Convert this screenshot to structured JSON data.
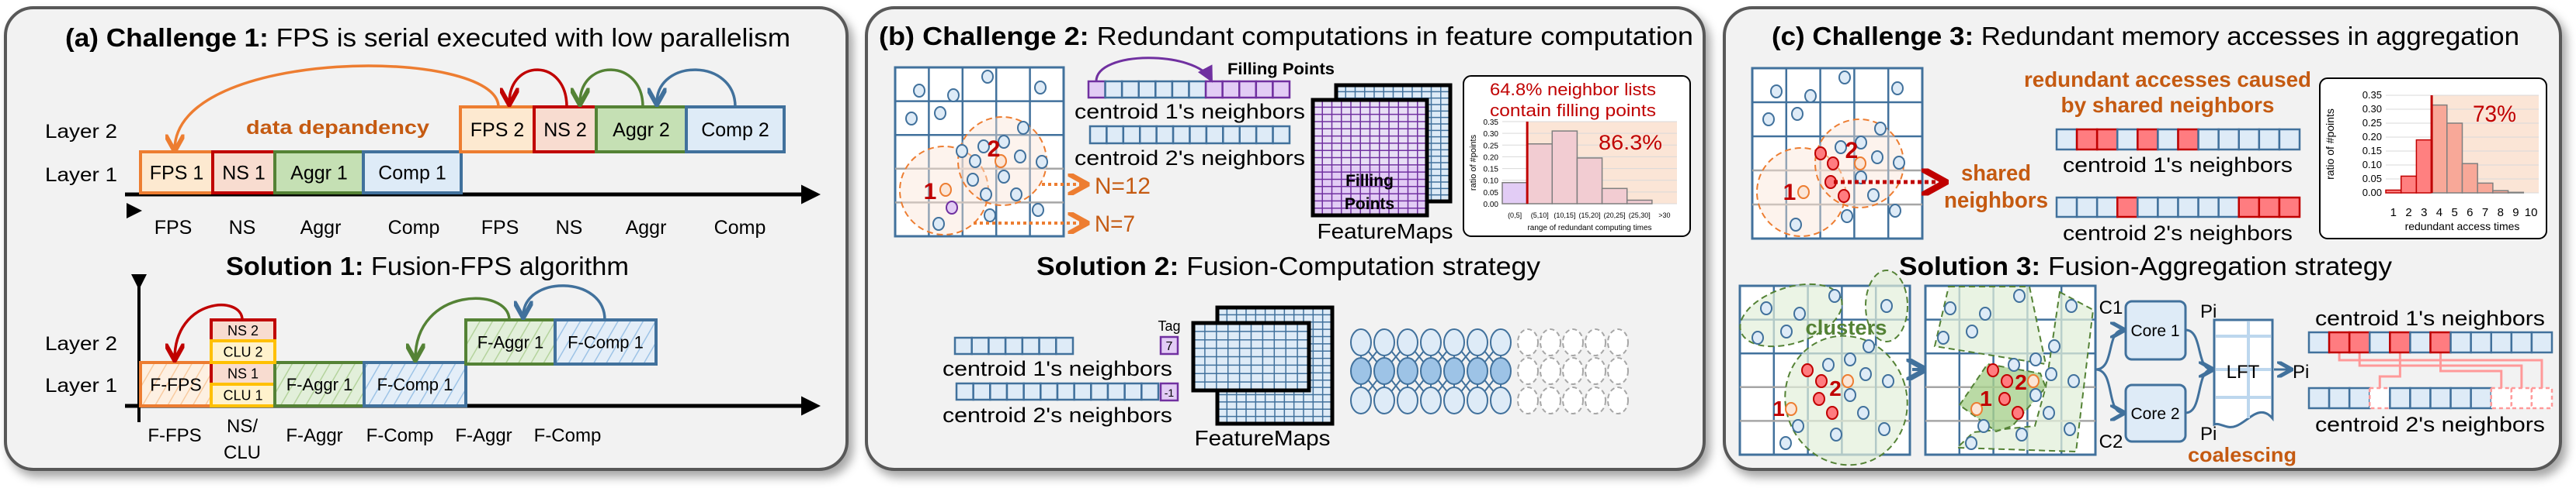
{
  "colors": {
    "fps": "#ed7d31",
    "ns": "#c00000",
    "aggr": "#548235",
    "comp": "#41719c",
    "clu": "#ffc000",
    "filling": "#7030a0",
    "annotation": "#c55a11",
    "highlight": "#c00000",
    "panel_bg": "#f2f2f2",
    "panel_border": "#595959"
  },
  "panel_a": {
    "title_prefix": "(a) Challenge 1:",
    "title_rest": " FPS is serial executed with low parallelism",
    "layer_labels": [
      "Layer 2",
      "Layer 1"
    ],
    "challenge": {
      "layer1_boxes": [
        "FPS 1",
        "NS 1",
        "Aggr 1",
        "Comp 1"
      ],
      "layer2_boxes": [
        "FPS 2",
        "NS 2",
        "Aggr 2",
        "Comp 2"
      ],
      "x_labels": [
        "FPS",
        "NS",
        "Aggr",
        "Comp",
        "FPS",
        "NS",
        "Aggr",
        "Comp"
      ],
      "annotation": "data depandency"
    },
    "solution_prefix": "Solution 1:",
    "solution_rest": " Fusion-FPS algorithm",
    "solution": {
      "layer1_boxes": [
        "F-FPS",
        "NS 1",
        "CLU 1",
        "F-Aggr 1",
        "F-Comp 1"
      ],
      "layer2_boxes": [
        "NS 2",
        "CLU 2",
        "F-Aggr 1",
        "F-Comp 1"
      ],
      "x_labels": [
        "F-FPS",
        "NS/",
        "CLU",
        "F-Aggr",
        "F-Comp",
        "F-Aggr",
        "F-Comp"
      ]
    }
  },
  "panel_b": {
    "title_prefix": "(b) Challenge 2:",
    "title_rest": " Redundant computations in feature computation",
    "centroid_labels": [
      "1",
      "2"
    ],
    "filling_points_label": "Filling Points",
    "neighbor_labels": [
      "centroid 1's neighbors",
      "centroid 2's neighbors"
    ],
    "n_labels": [
      "N=12",
      "N=7"
    ],
    "featuremaps_label": "FeatureMaps",
    "featuremap_filling": [
      "Filling",
      "Points"
    ],
    "histogram": {
      "type": "bar",
      "annotation": [
        "64.8% neighbor lists",
        "contain filling points"
      ],
      "highlight": "86.3%",
      "ylabel": "ratio of #points",
      "xlabel": "range of redundant computing times",
      "categories": [
        "(0,5]",
        "(5,10]",
        "(10,15]",
        "(15,20]",
        "(20,25]",
        "(25,30]",
        ">30"
      ],
      "values": [
        0.09,
        0.255,
        0.31,
        0.195,
        0.065,
        0.015,
        0.0
      ],
      "yticks": [
        "0.00",
        "0.05",
        "0.10",
        "0.15",
        "0.20",
        "0.25",
        "0.30",
        "0.35"
      ],
      "ylim": [
        0,
        0.35
      ],
      "threshold_after_category": "(0,5]"
    },
    "solution_prefix": "Solution 2:",
    "solution_rest": " Fusion-Computation strategy",
    "tag_label": "Tag",
    "tags": [
      "7",
      "-1"
    ],
    "solution_neighbor_labels": [
      "centroid 1's neighbors",
      "centroid 2's neighbors"
    ],
    "solution_featuremaps_label": "FeatureMaps"
  },
  "panel_c": {
    "title_prefix": "(c) Challenge 3:",
    "title_rest": " Redundant memory accesses in aggregation",
    "centroid_labels": [
      "1",
      "2"
    ],
    "shared_label": [
      "shared",
      "neighbors"
    ],
    "redundant_label": [
      "redundant accesses caused",
      "by shared neighbors"
    ],
    "neighbor_labels": [
      "centroid 1's neighbors",
      "centroid 2's neighbors"
    ],
    "histogram": {
      "type": "bar",
      "highlight": "73%",
      "ylabel": "ratio of #points",
      "xlabel": "redundant access times",
      "categories": [
        "1",
        "2",
        "3",
        "4",
        "5",
        "6",
        "7",
        "8",
        "9",
        "10"
      ],
      "values": [
        0.01,
        0.06,
        0.19,
        0.315,
        0.25,
        0.105,
        0.035,
        0.008,
        0.002,
        0.0
      ],
      "yticks": [
        "0.00",
        "0.05",
        "0.10",
        "0.15",
        "0.20",
        "0.25",
        "0.30",
        "0.35"
      ],
      "ylim": [
        0,
        0.35
      ],
      "threshold_after_category": "3"
    },
    "solution_prefix": "Solution 3:",
    "solution_rest": " Fusion-Aggregation strategy",
    "clusters_label": "clusters",
    "solution_centroid_labels": [
      "1",
      "2"
    ],
    "solution_centroid_labels_2": [
      "1",
      "2"
    ],
    "core_labels": [
      "Core 1",
      "Core 2"
    ],
    "channel_labels": [
      "C1",
      "C2"
    ],
    "pi_label": "Pi",
    "lft_label": "LFT",
    "coalescing_label": "coalescing",
    "solution_neighbor_labels": [
      "centroid 1's neighbors",
      "centroid 2's neighbors"
    ]
  }
}
